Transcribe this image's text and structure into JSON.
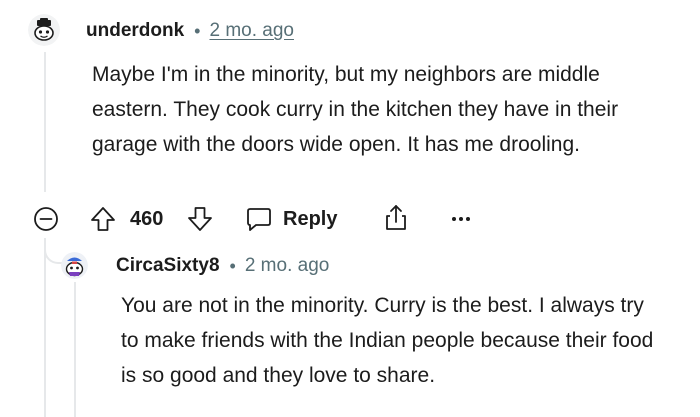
{
  "comments": [
    {
      "username": "underdonk",
      "separator": "•",
      "timestamp": "2 mo. ago",
      "body": "Maybe I'm in the minority, but my neighbors are middle eastern. They cook curry in the kitchen they have in their garage with the doors wide open. It has me drooling."
    },
    {
      "username": "CircaSixty8",
      "separator": "•",
      "timestamp": "2 mo. ago",
      "body": "You are not in the minority. Curry is the best. I always try to make friends with the Indian people because their food is so good and they love to share."
    }
  ],
  "actions": {
    "collapse_icon": "collapse-circle-icon",
    "upvote_icon": "upvote-arrow-icon",
    "vote_count": "460",
    "downvote_icon": "downvote-arrow-icon",
    "reply_icon": "speech-bubble-icon",
    "reply_label": "Reply",
    "share_icon": "share-icon",
    "more_icon": "ellipsis-icon"
  },
  "colors": {
    "text": "#1c1c1c",
    "meta": "#576f76",
    "thread_line": "#e6e8ea"
  }
}
